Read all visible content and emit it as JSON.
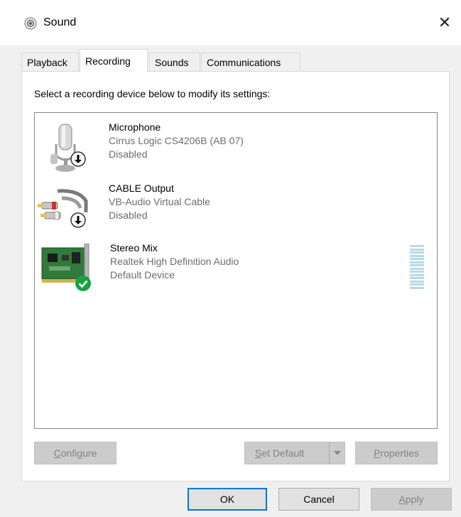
{
  "window": {
    "title": "Sound",
    "close_glyph": "✕",
    "icon": "speaker-icon"
  },
  "tabs": [
    {
      "label": "Playback",
      "active": false
    },
    {
      "label": "Recording",
      "active": true
    },
    {
      "label": "Sounds",
      "active": false
    },
    {
      "label": "Communications",
      "active": false
    }
  ],
  "instructions": "Select a recording device below to modify its settings:",
  "devices": [
    {
      "name": "Microphone",
      "driver": "Cirrus Logic CS4206B (AB 07)",
      "status": "Disabled",
      "icon": "microphone-icon",
      "badge": "disabled-arrow-icon"
    },
    {
      "name": "CABLE Output",
      "driver": "VB-Audio Virtual Cable",
      "status": "Disabled",
      "icon": "rca-cable-icon",
      "badge": "disabled-arrow-icon"
    },
    {
      "name": "Stereo Mix",
      "driver": "Realtek High Definition Audio",
      "status": "Default Device",
      "icon": "sound-card-icon",
      "badge": "default-check-icon",
      "level_bars": 14
    }
  ],
  "buttons": {
    "configure": {
      "prefix": "",
      "accel": "C",
      "rest": "onfigure",
      "enabled": false
    },
    "set_default": {
      "prefix": "",
      "accel": "S",
      "rest": "et Default",
      "enabled": false
    },
    "properties": {
      "prefix": "",
      "accel": "P",
      "rest": "roperties",
      "enabled": false
    },
    "ok": {
      "label": "OK",
      "enabled": true
    },
    "cancel": {
      "label": "Cancel",
      "enabled": true
    },
    "apply": {
      "prefix": "",
      "accel": "A",
      "rest": "pply",
      "enabled": false
    }
  },
  "colors": {
    "accent": "#0078d7",
    "default_check": "#18a33f",
    "level_meter": "#b8d9e6",
    "secondary_text": "#6d6d6d"
  }
}
